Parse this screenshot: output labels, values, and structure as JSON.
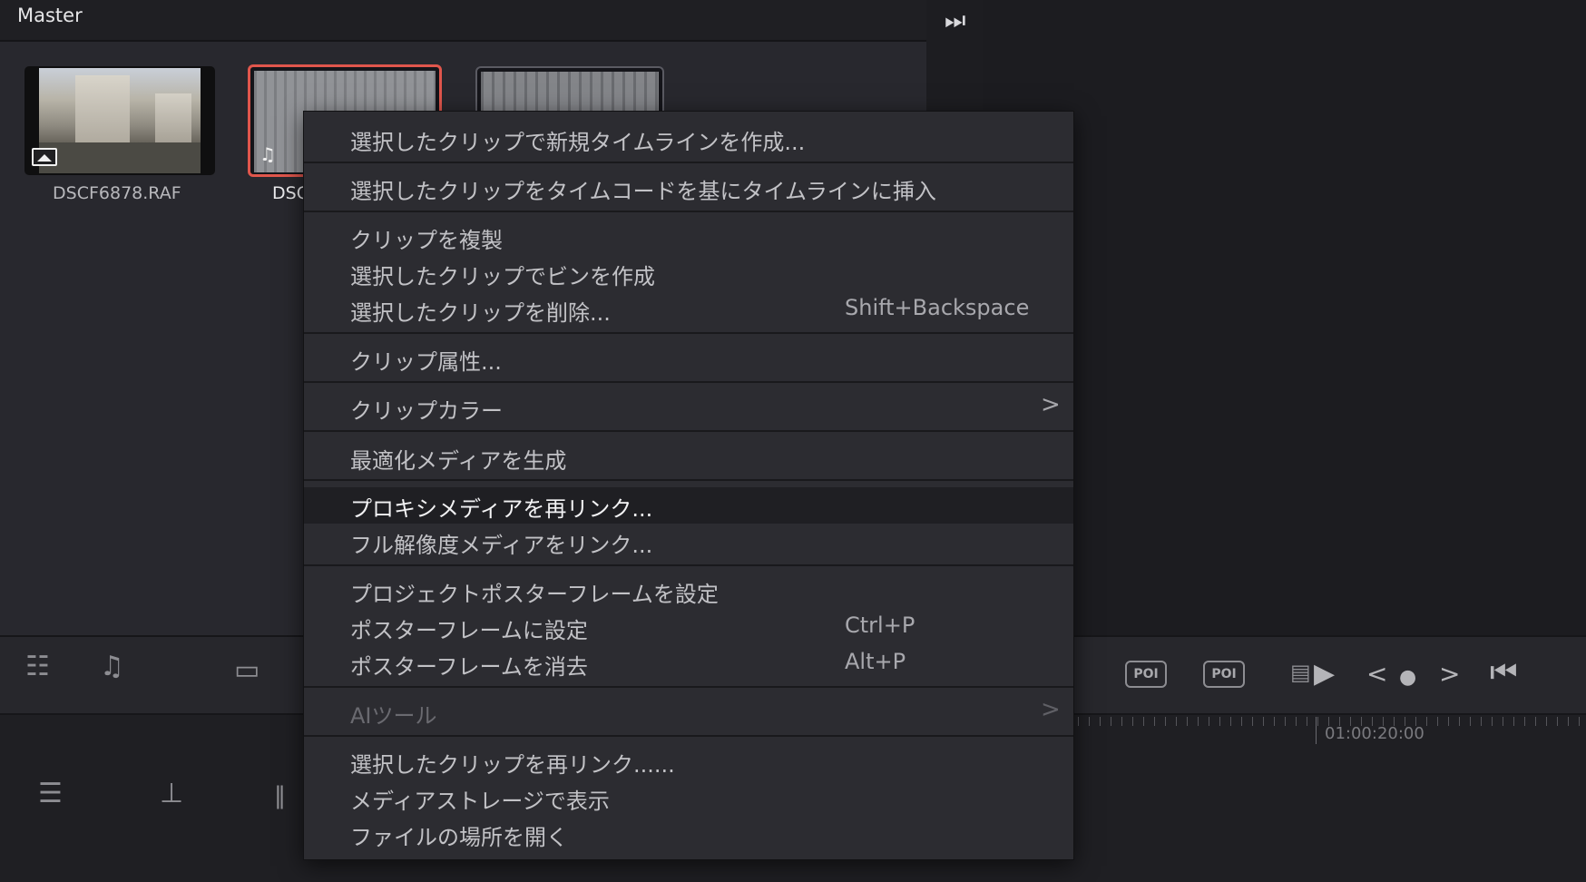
{
  "pool": {
    "title": "Master",
    "clips": [
      {
        "name": "DSCF6878.RAF",
        "type": "image-icon"
      },
      {
        "name": "DSC",
        "type": "music-note-icon"
      }
    ]
  },
  "context_menu": {
    "items": [
      {
        "label": "選択したクリップで新規タイムラインを作成..."
      },
      {
        "label": "選択したクリップをタイムコードを基にタイムラインに挿入"
      },
      {
        "label": "クリップを複製"
      },
      {
        "label": "選択したクリップでビンを作成"
      },
      {
        "label": "選択したクリップを削除...",
        "shortcut": "Shift+Backspace"
      },
      {
        "label": "クリップ属性..."
      },
      {
        "label": "クリップカラー",
        "arrow": ">"
      },
      {
        "label": "最適化メディアを生成"
      },
      {
        "label": "プロキシメディアを再リンク..."
      },
      {
        "label": "フル解像度メディアをリンク..."
      },
      {
        "label": "プロジェクトポスターフレームを設定"
      },
      {
        "label": "ポスターフレームに設定",
        "shortcut": "Ctrl+P"
      },
      {
        "label": "ポスターフレームを消去",
        "shortcut": "Alt+P"
      },
      {
        "label": "AIツール",
        "arrow": ">"
      },
      {
        "label": "選択したクリップを再リンク......"
      },
      {
        "label": "メディアストレージで表示"
      },
      {
        "label": "ファイルの場所を開く"
      }
    ]
  },
  "toolbar": {
    "poi_label": "POI",
    "play_icon": "▶",
    "prev_icon": "<",
    "next_icon": ">",
    "dot_icon": "●",
    "jump_start_icon": "⏮"
  },
  "timeline": {
    "timecode": "01:00:20:00"
  },
  "colors": {
    "accent_selection": "#e0564c",
    "menu_bg": "#2c2c31",
    "menu_highlight": "#1f1f23"
  }
}
